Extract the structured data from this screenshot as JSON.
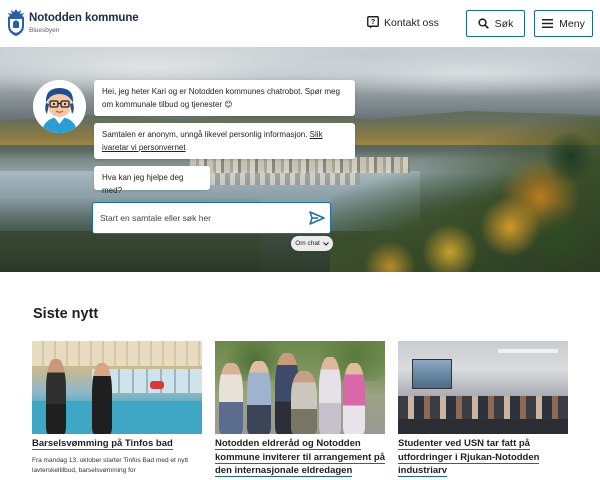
{
  "header": {
    "logo_title": "Notodden kommune",
    "logo_subtitle": "Bluesbyen",
    "contact_label": "Kontakt oss",
    "search_label": "Søk",
    "menu_label": "Meny"
  },
  "chat": {
    "greeting": "Hei, jeg heter Kari og er Notodden kommunes chatrobot. Spør meg om kommunale tilbud og tjenester 😊",
    "privacy_text": "Samtalen er anonym, unngå likevel personlig informasjon. ",
    "privacy_link": "Slik ivaretar vi personvernet",
    "question": "Hva kan jeg hjelpe deg med?",
    "input_placeholder": "Start en samtale eller søk her",
    "about_label": "Om chat"
  },
  "news": {
    "section_title": "Siste nytt",
    "items": [
      {
        "title": "Barselsvømming på Tinfos bad",
        "description": "Fra mandag 13. oktober starter Tinfos Bad med et nytt lavterskeltilbud, barselsvømming for"
      },
      {
        "title": "Notodden eldreråd og Notodden kommune inviterer til arrangement på den internasjonale eldredagen",
        "description": ""
      },
      {
        "title": "Studenter ved USN tar fatt på utfordringer i Rjukan-Notodden industriarv",
        "description": ""
      }
    ]
  },
  "colors": {
    "accent": "#1a6d80",
    "chat_border": "#1f6fa8",
    "brand_navy": "#1d2b4d"
  }
}
